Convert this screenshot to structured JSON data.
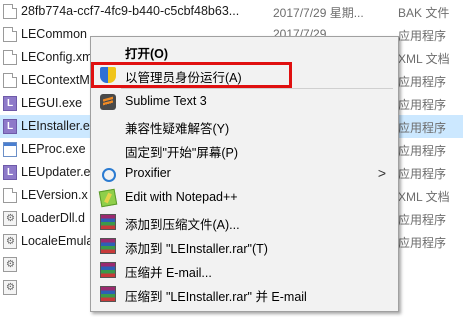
{
  "files": [
    {
      "name": "28fb774a-ccf7-4fc9-b440-c5cbf48b63...",
      "date": "2017/7/29 星期...",
      "type": "BAK 文件",
      "icon": "document-icon"
    },
    {
      "name": "LECommon",
      "date": "2017/7/29",
      "type": "应用程序",
      "icon": "document-icon"
    },
    {
      "name": "LEConfig.xm",
      "date": "",
      "type": "XML 文档",
      "icon": "document-icon"
    },
    {
      "name": "LEContextM",
      "date": "",
      "type": "应用程序",
      "icon": "document-icon"
    },
    {
      "name": "LEGUI.exe",
      "date": "",
      "type": "应用程序",
      "icon": "le-app-icon"
    },
    {
      "name": "LEInstaller.e",
      "date": "",
      "type": "应用程序",
      "icon": "le-app-icon",
      "selected": true
    },
    {
      "name": "LEProc.exe",
      "date": "",
      "type": "应用程序",
      "icon": "exe-icon"
    },
    {
      "name": "LEUpdater.e",
      "date": "",
      "type": "应用程序",
      "icon": "le-app-icon"
    },
    {
      "name": "LEVersion.x",
      "date": "",
      "type": "XML 文档",
      "icon": "document-icon"
    },
    {
      "name": "LoaderDll.d",
      "date": "",
      "type": "应用程序",
      "icon": "gear-document-icon"
    },
    {
      "name": "LocaleEmula",
      "date": "",
      "type": "应用程序",
      "icon": "gear-document-icon"
    },
    {
      "name": "",
      "date": "",
      "type": "",
      "icon": "gear-document-icon"
    }
  ],
  "context_menu": {
    "items": [
      {
        "label": "打开(O)",
        "bold": true,
        "icon": ""
      },
      {
        "label": "以管理员身份运行(A)",
        "icon": "uac-shield-icon",
        "highlighted": true
      },
      {
        "label": "Sublime Text 3",
        "icon": "sublime-text-icon"
      },
      {
        "label": "兼容性疑难解答(Y)",
        "icon": ""
      },
      {
        "label": "固定到\"开始\"屏幕(P)",
        "icon": ""
      },
      {
        "label": "Proxifier",
        "icon": "proxifier-icon",
        "submenu": true
      },
      {
        "label": "Edit with Notepad++",
        "icon": "notepad-plus-plus-icon"
      },
      {
        "label": "添加到压缩文件(A)...",
        "icon": "winrar-icon"
      },
      {
        "label": "添加到 \"LEInstaller.rar\"(T)",
        "icon": "winrar-icon"
      },
      {
        "label": "压缩并 E-mail...",
        "icon": "winrar-icon"
      },
      {
        "label": "压缩到 \"LEInstaller.rar\" 并 E-mail",
        "icon": "winrar-icon"
      }
    ],
    "submenu_arrow": ">"
  },
  "colors": {
    "selection": "#cce8ff",
    "highlight_box": "#e01010",
    "menu_bg": "#f2f2f2"
  }
}
